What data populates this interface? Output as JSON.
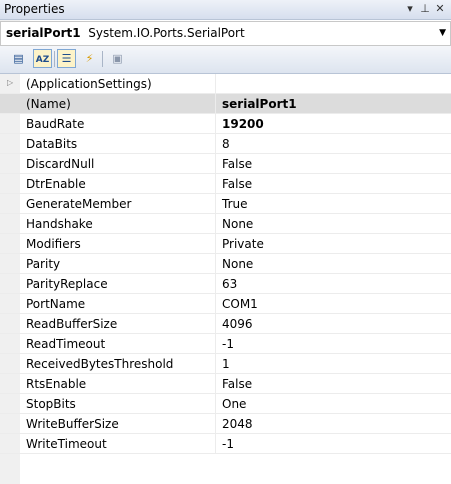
{
  "window": {
    "title": "Properties"
  },
  "selector": {
    "object_name": "serialPort1",
    "object_type": "System.IO.Ports.SerialPort"
  },
  "toolbar": {
    "buttons": [
      {
        "name": "categorized-icon",
        "active": false
      },
      {
        "name": "alphabetical-icon",
        "active": true
      },
      {
        "name": "properties-icon",
        "active": true
      },
      {
        "name": "events-icon",
        "active": false
      },
      {
        "name": "property-pages-icon",
        "active": false
      }
    ]
  },
  "properties": [
    {
      "name": "(ApplicationSettings)",
      "value": "",
      "expandable": true,
      "bold": false,
      "selected": false
    },
    {
      "name": "(Name)",
      "value": "serialPort1",
      "expandable": false,
      "bold": true,
      "selected": true
    },
    {
      "name": "BaudRate",
      "value": "19200",
      "expandable": false,
      "bold": true,
      "selected": false
    },
    {
      "name": "DataBits",
      "value": "8",
      "expandable": false,
      "bold": false,
      "selected": false
    },
    {
      "name": "DiscardNull",
      "value": "False",
      "expandable": false,
      "bold": false,
      "selected": false
    },
    {
      "name": "DtrEnable",
      "value": "False",
      "expandable": false,
      "bold": false,
      "selected": false
    },
    {
      "name": "GenerateMember",
      "value": "True",
      "expandable": false,
      "bold": false,
      "selected": false
    },
    {
      "name": "Handshake",
      "value": "None",
      "expandable": false,
      "bold": false,
      "selected": false
    },
    {
      "name": "Modifiers",
      "value": "Private",
      "expandable": false,
      "bold": false,
      "selected": false
    },
    {
      "name": "Parity",
      "value": "None",
      "expandable": false,
      "bold": false,
      "selected": false
    },
    {
      "name": "ParityReplace",
      "value": "63",
      "expandable": false,
      "bold": false,
      "selected": false
    },
    {
      "name": "PortName",
      "value": "COM1",
      "expandable": false,
      "bold": false,
      "selected": false
    },
    {
      "name": "ReadBufferSize",
      "value": "4096",
      "expandable": false,
      "bold": false,
      "selected": false
    },
    {
      "name": "ReadTimeout",
      "value": "-1",
      "expandable": false,
      "bold": false,
      "selected": false
    },
    {
      "name": "ReceivedBytesThreshold",
      "value": "1",
      "expandable": false,
      "bold": false,
      "selected": false
    },
    {
      "name": "RtsEnable",
      "value": "False",
      "expandable": false,
      "bold": false,
      "selected": false
    },
    {
      "name": "StopBits",
      "value": "One",
      "expandable": false,
      "bold": false,
      "selected": false
    },
    {
      "name": "WriteBufferSize",
      "value": "2048",
      "expandable": false,
      "bold": false,
      "selected": false
    },
    {
      "name": "WriteTimeout",
      "value": "-1",
      "expandable": false,
      "bold": false,
      "selected": false
    }
  ]
}
